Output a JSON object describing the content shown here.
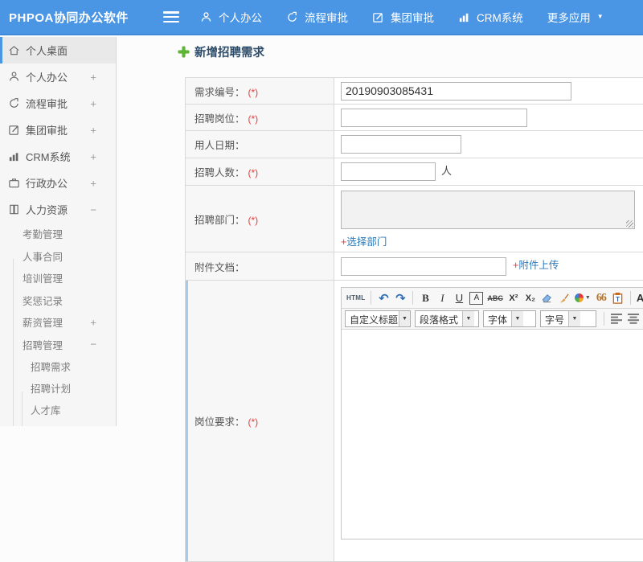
{
  "app": {
    "title": "PHPOA协同办公软件"
  },
  "header": {
    "nav": [
      {
        "label": "个人办公"
      },
      {
        "label": "流程审批"
      },
      {
        "label": "集团审批"
      },
      {
        "label": "CRM系统"
      },
      {
        "label": "更多应用"
      }
    ]
  },
  "sidebar": {
    "items": [
      {
        "label": "个人桌面"
      },
      {
        "label": "个人办公",
        "expander": "+"
      },
      {
        "label": "流程审批",
        "expander": "+"
      },
      {
        "label": "集团审批",
        "expander": "+"
      },
      {
        "label": "CRM系统",
        "expander": "+"
      },
      {
        "label": "行政办公",
        "expander": "+"
      },
      {
        "label": "人力资源",
        "expander": "−"
      }
    ],
    "hr_children": [
      {
        "label": "考勤管理"
      },
      {
        "label": "人事合同"
      },
      {
        "label": "培训管理"
      },
      {
        "label": "奖惩记录"
      },
      {
        "label": "薪资管理",
        "expander": "+"
      },
      {
        "label": "招聘管理",
        "expander": "−"
      }
    ],
    "recruit_children": [
      {
        "label": "招聘需求"
      },
      {
        "label": "招聘计划"
      },
      {
        "label": "人才库"
      }
    ]
  },
  "main": {
    "page_title": "新增招聘需求",
    "form": {
      "rows": [
        {
          "label": "需求编号：",
          "required": "(*)",
          "value": "20190903085431"
        },
        {
          "label": "招聘岗位：",
          "required": "(*)",
          "value": ""
        },
        {
          "label": "用人日期：",
          "value": ""
        },
        {
          "label": "招聘人数：",
          "required": "(*)",
          "value": "",
          "suffix": "人"
        },
        {
          "label": "招聘部门：",
          "required": "(*)",
          "link_plus": "+",
          "link_text": "选择部门"
        },
        {
          "label": "附件文档：",
          "value": "",
          "link_plus": "+",
          "link_text": "附件上传"
        },
        {
          "label": "岗位要求：",
          "required": "(*)"
        }
      ]
    },
    "editor": {
      "html_label": "HTML",
      "bold_label": "B",
      "italic_label": "I",
      "underline_label": "U",
      "fontbox_label": "A",
      "strike_label": "ABC",
      "superscript_label": "X²",
      "subscript_label": "X₂",
      "quote_label": "66",
      "fontcolor_label": "A",
      "dropdowns": [
        {
          "label": "自定义标题"
        },
        {
          "label": "段落格式"
        },
        {
          "label": "字体"
        },
        {
          "label": "字号"
        }
      ]
    }
  },
  "colors": {
    "header_blue": "#4a95e4",
    "accent": "#4a95e4",
    "link_blue": "#2b77b8",
    "required_red": "#e43c3c",
    "plus_green": "#5fb832"
  }
}
